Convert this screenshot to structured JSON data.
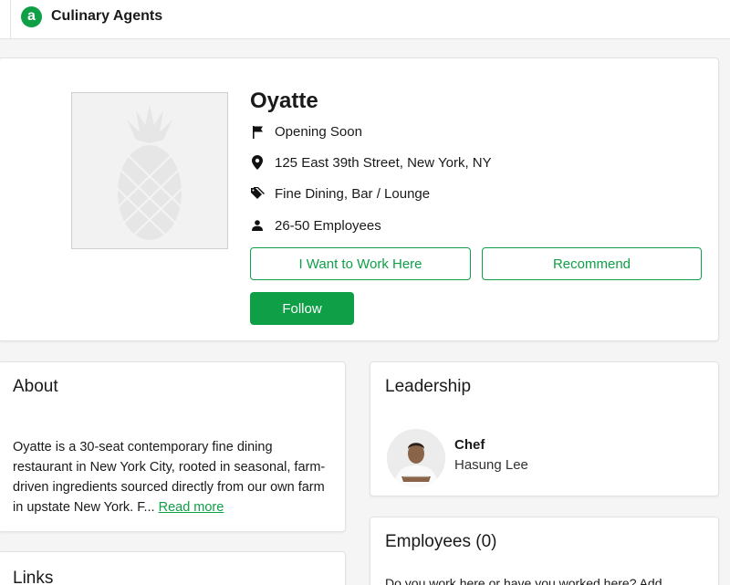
{
  "header": {
    "brand": "Culinary Agents",
    "logo_letter": "a"
  },
  "company": {
    "name": "Oyatte",
    "status": "Opening Soon",
    "address": "125 East 39th Street, New York, NY",
    "categories": "Fine Dining, Bar / Lounge",
    "size": "26-50 Employees",
    "image_icon": "pineapple-placeholder-icon"
  },
  "actions": {
    "work_here": "I Want to Work Here",
    "recommend": "Recommend",
    "follow": "Follow"
  },
  "about": {
    "title": "About",
    "text": "Oyatte is a 30-seat contemporary fine dining restaurant in New York City, rooted in seasonal, farm-driven ingredients sourced directly from our own farm in upstate New York. F...",
    "read_more": "Read more"
  },
  "links": {
    "title": "Links"
  },
  "leadership": {
    "title": "Leadership",
    "members": [
      {
        "role": "Chef",
        "name": "Hasung Lee"
      }
    ]
  },
  "employees": {
    "title": "Employees (0)",
    "prompt": "Do you work here or have you worked here? Add"
  },
  "colors": {
    "accent": "#0e9f47",
    "background": "#f5f5f5"
  }
}
